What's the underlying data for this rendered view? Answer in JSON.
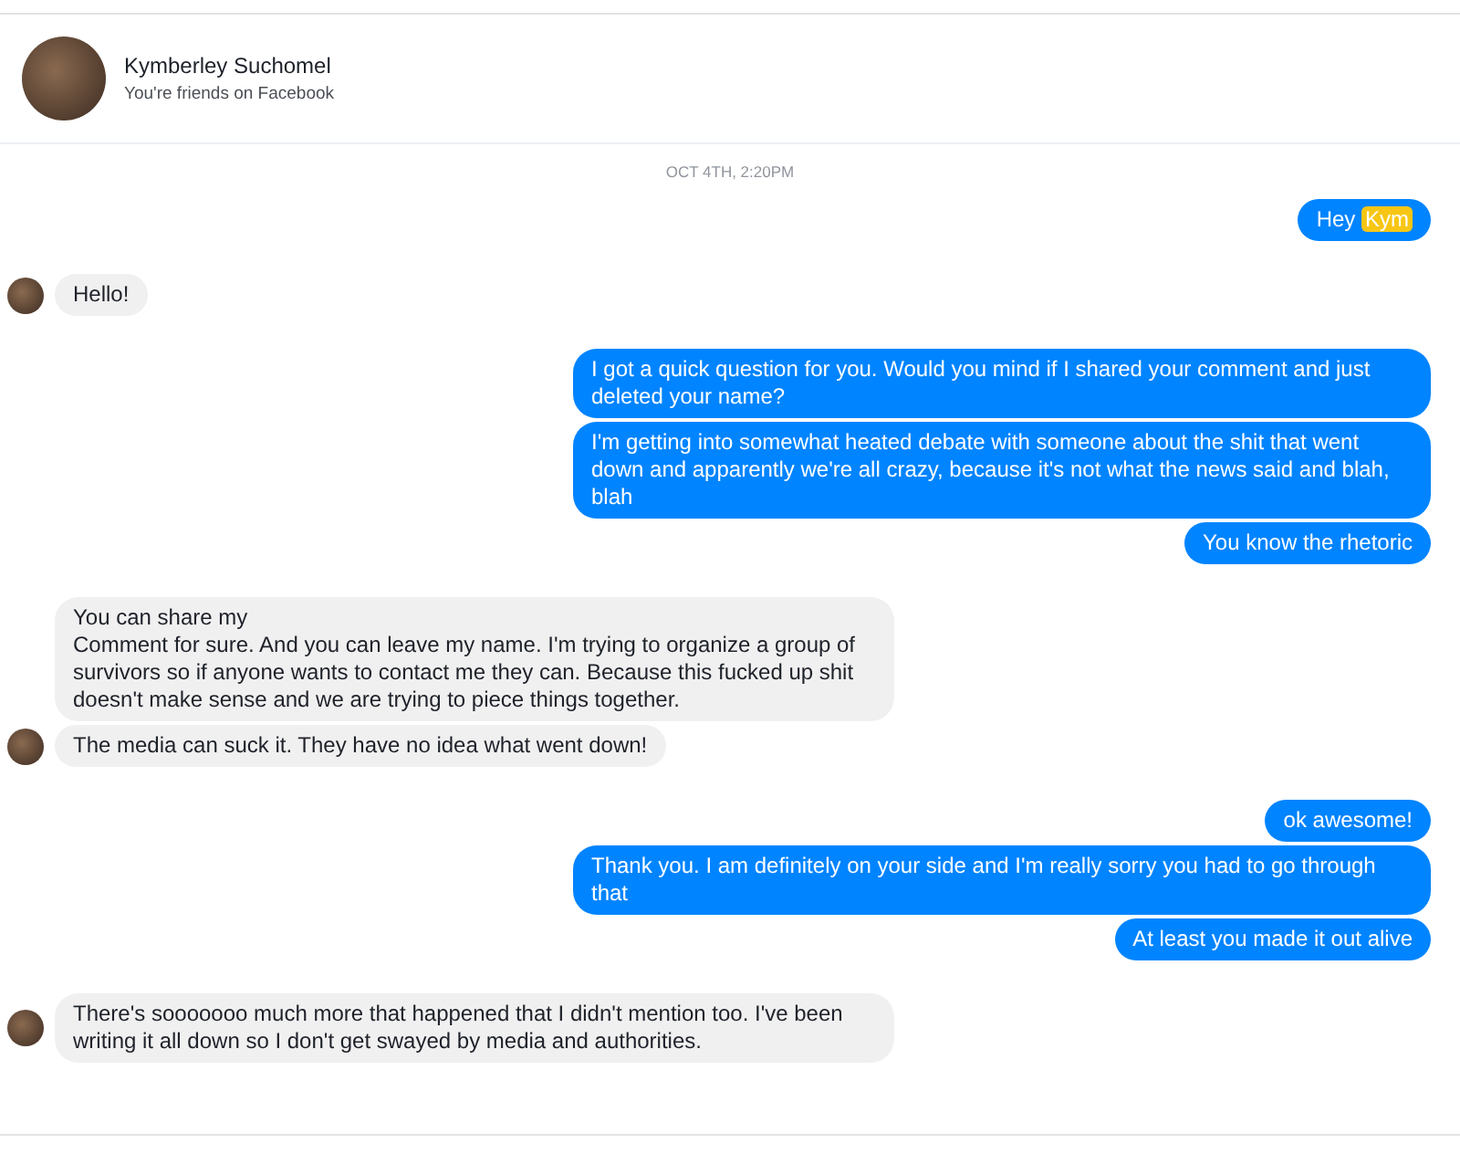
{
  "contact": {
    "name": "Kymberley Suchomel",
    "subtitle": "You're friends on Facebook"
  },
  "timestamp": "OCT 4TH, 2:20PM",
  "groups": [
    {
      "kind": "outgoing",
      "messages": [
        {
          "text": "Hey",
          "highlight": "Kym"
        }
      ]
    },
    {
      "kind": "incoming",
      "messages": [
        {
          "text": "Hello!"
        }
      ]
    },
    {
      "kind": "outgoing",
      "messages": [
        {
          "text": "I got a quick question for you. Would you mind if I shared your comment and just deleted your name?"
        },
        {
          "text": "I'm getting into somewhat heated debate with someone about the shit that went down and apparently we're all crazy, because it's not what the news said and blah, blah"
        },
        {
          "text": "You know the rhetoric"
        }
      ]
    },
    {
      "kind": "incoming",
      "messages": [
        {
          "text": "You can share my\nComment for sure. And you can leave my name. I'm trying to organize a group of survivors so if anyone wants to contact me they can. Because this fucked up shit doesn't make sense and we are trying to piece things together."
        },
        {
          "text": "The media can suck it. They have no idea what went down!"
        }
      ]
    },
    {
      "kind": "outgoing",
      "messages": [
        {
          "text": "ok awesome!"
        },
        {
          "text": "Thank you. I am definitely on your side and I'm really sorry you had to go through that"
        },
        {
          "text": "At least you made it out alive"
        }
      ]
    },
    {
      "kind": "incoming",
      "messages": [
        {
          "text": "There's sooooooo much more that happened that I didn't mention too. I've been writing it all down so I don't get swayed by media and authorities."
        }
      ]
    }
  ]
}
